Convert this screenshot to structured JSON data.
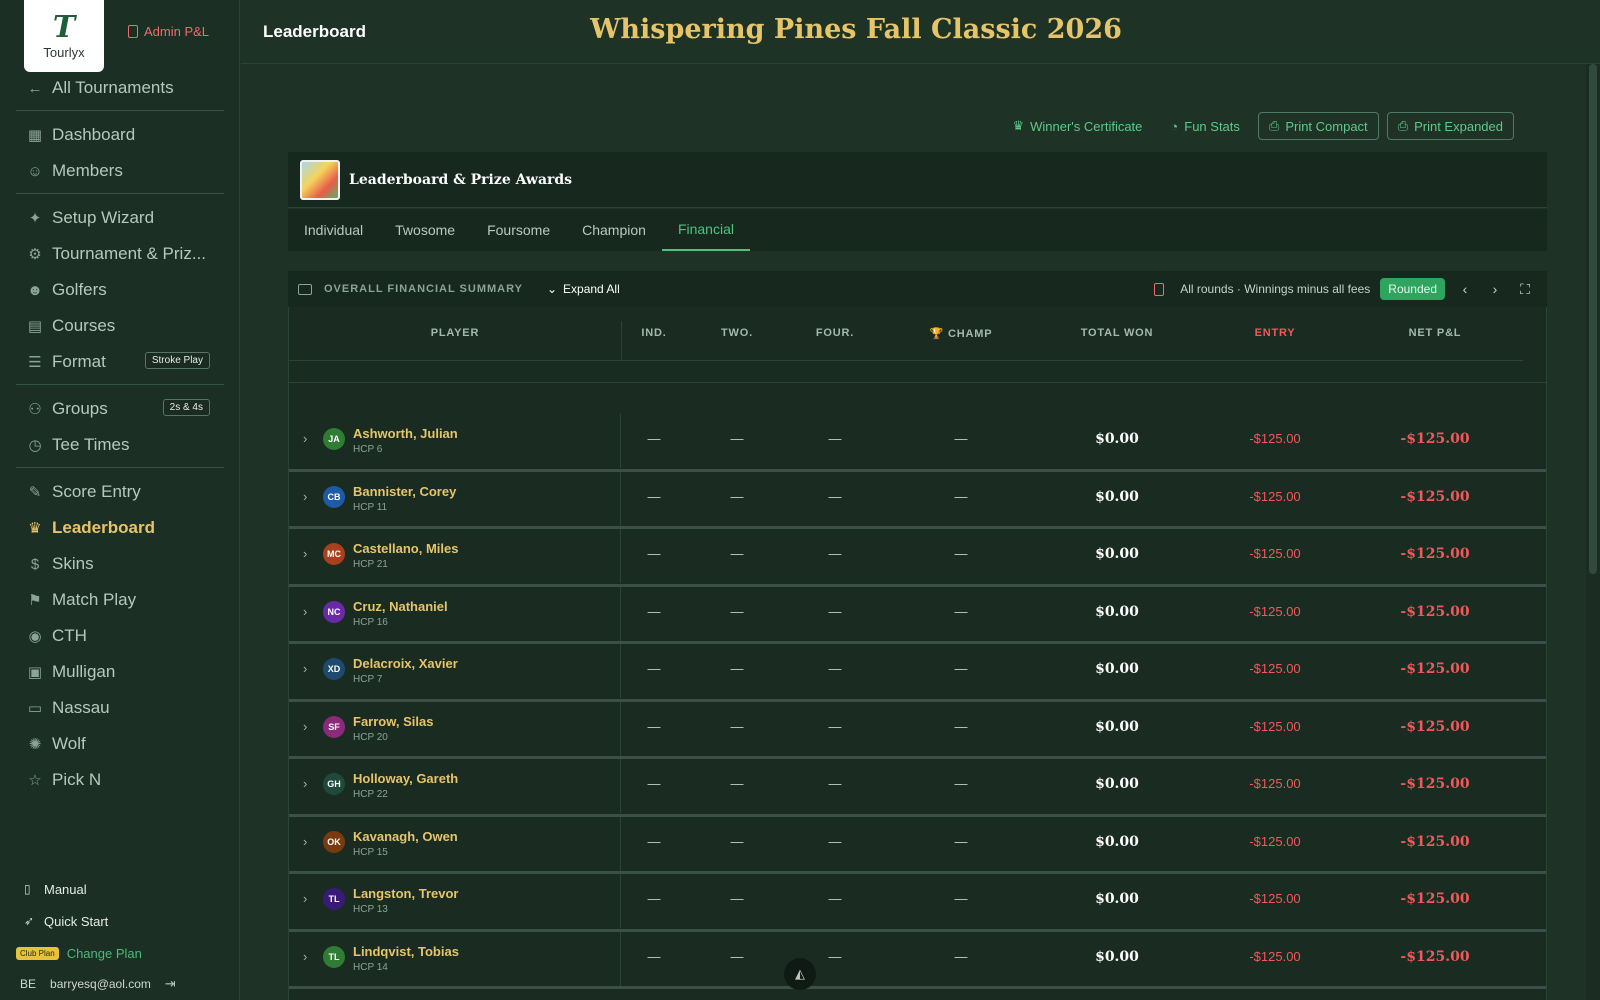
{
  "app": {
    "logo_text": "Tourlyx",
    "logo_mark": "T",
    "admin_label": "Admin P&L"
  },
  "nav": {
    "back": "All Tournaments",
    "items": [
      {
        "label": "Dashboard",
        "icon": "grid-icon"
      },
      {
        "label": "Members",
        "icon": "user-add-icon"
      },
      {
        "label": "Setup Wizard",
        "icon": "sparkle-icon"
      },
      {
        "label": "Tournament & Priz...",
        "icon": "gear-icon"
      },
      {
        "label": "Golfers",
        "icon": "users-icon"
      },
      {
        "label": "Courses",
        "icon": "map-icon"
      },
      {
        "label": "Format",
        "icon": "sliders-icon",
        "badge": "Stroke Play"
      },
      {
        "label": "Groups",
        "icon": "group-icon",
        "badge": "2s & 4s"
      },
      {
        "label": "Tee Times",
        "icon": "clock-icon"
      },
      {
        "label": "Score Entry",
        "icon": "edit-icon"
      },
      {
        "label": "Leaderboard",
        "icon": "trophy-icon"
      },
      {
        "label": "Skins",
        "icon": "dollar-icon"
      },
      {
        "label": "Match Play",
        "icon": "flag-icon"
      },
      {
        "label": "CTH",
        "icon": "pin-icon"
      },
      {
        "label": "Mulligan",
        "icon": "ticket-icon"
      },
      {
        "label": "Nassau",
        "icon": "money-icon"
      },
      {
        "label": "Wolf",
        "icon": "wolf-icon"
      },
      {
        "label": "Pick N",
        "icon": "star-icon"
      }
    ]
  },
  "sidebar_bottom": {
    "manual": "Manual",
    "quick_start": "Quick Start",
    "plan_badge": "Club Plan",
    "change_plan": "Change Plan",
    "user_initials": "BE",
    "user_email": "barryesq@aol.com"
  },
  "header": {
    "page": "Leaderboard",
    "event_title": "Whispering Pines Fall Classic 2026"
  },
  "actions": {
    "certificate": "Winner's Certificate",
    "fun_stats": "Fun Stats",
    "print_compact": "Print Compact",
    "print_expanded": "Print Expanded"
  },
  "card": {
    "title": "Leaderboard & Prize Awards"
  },
  "tabs": [
    "Individual",
    "Twosome",
    "Foursome",
    "Champion",
    "Financial"
  ],
  "active_tab": "Financial",
  "summary": {
    "label": "OVERALL FINANCIAL SUMMARY",
    "expand": "Expand All",
    "note": "All rounds · Winnings minus all fees",
    "rounded": "Rounded"
  },
  "table": {
    "headers": {
      "player": "PLAYER",
      "ind": "IND.",
      "two": "TWO.",
      "four": "FOUR.",
      "champ": "🏆 CHAMP",
      "total": "TOTAL WON",
      "entry": "ENTRY",
      "net": "NET P&L"
    },
    "rows": [
      {
        "initials": "JA",
        "color": "#2e7d32",
        "name": "Ashworth, Julian",
        "hcp": "HCP 6",
        "ind": "—",
        "two": "—",
        "four": "—",
        "champ": "—",
        "total": "$0.00",
        "entry": "-$125.00",
        "net": "-$125.00"
      },
      {
        "initials": "CB",
        "color": "#1e5aa8",
        "name": "Bannister, Corey",
        "hcp": "HCP 11",
        "ind": "—",
        "two": "—",
        "four": "—",
        "champ": "—",
        "total": "$0.00",
        "entry": "-$125.00",
        "net": "-$125.00"
      },
      {
        "initials": "MC",
        "color": "#a8401e",
        "name": "Castellano, Miles",
        "hcp": "HCP 21",
        "ind": "—",
        "two": "—",
        "four": "—",
        "champ": "—",
        "total": "$0.00",
        "entry": "-$125.00",
        "net": "-$125.00"
      },
      {
        "initials": "NC",
        "color": "#6a2aa8",
        "name": "Cruz, Nathaniel",
        "hcp": "HCP 16",
        "ind": "—",
        "two": "—",
        "four": "—",
        "champ": "—",
        "total": "$0.00",
        "entry": "-$125.00",
        "net": "-$125.00"
      },
      {
        "initials": "XD",
        "color": "#1e4a70",
        "name": "Delacroix, Xavier",
        "hcp": "HCP 7",
        "ind": "—",
        "two": "—",
        "four": "—",
        "champ": "—",
        "total": "$0.00",
        "entry": "-$125.00",
        "net": "-$125.00"
      },
      {
        "initials": "SF",
        "color": "#8a2a78",
        "name": "Farrow, Silas",
        "hcp": "HCP 20",
        "ind": "—",
        "two": "—",
        "four": "—",
        "champ": "—",
        "total": "$0.00",
        "entry": "-$125.00",
        "net": "-$125.00"
      },
      {
        "initials": "GH",
        "color": "#1f4a3a",
        "name": "Holloway, Gareth",
        "hcp": "HCP 22",
        "ind": "—",
        "two": "—",
        "four": "—",
        "champ": "—",
        "total": "$0.00",
        "entry": "-$125.00",
        "net": "-$125.00"
      },
      {
        "initials": "OK",
        "color": "#7a3a10",
        "name": "Kavanagh, Owen",
        "hcp": "HCP 15",
        "ind": "—",
        "two": "—",
        "four": "—",
        "champ": "—",
        "total": "$0.00",
        "entry": "-$125.00",
        "net": "-$125.00"
      },
      {
        "initials": "TL",
        "color": "#3a1a78",
        "name": "Langston, Trevor",
        "hcp": "HCP 13",
        "ind": "—",
        "two": "—",
        "four": "—",
        "champ": "—",
        "total": "$0.00",
        "entry": "-$125.00",
        "net": "-$125.00"
      },
      {
        "initials": "TL",
        "color": "#2e7d32",
        "name": "Lindqvist, Tobias",
        "hcp": "HCP 14",
        "ind": "—",
        "two": "—",
        "four": "—",
        "champ": "—",
        "total": "$0.00",
        "entry": "-$125.00",
        "net": "-$125.00"
      }
    ]
  }
}
